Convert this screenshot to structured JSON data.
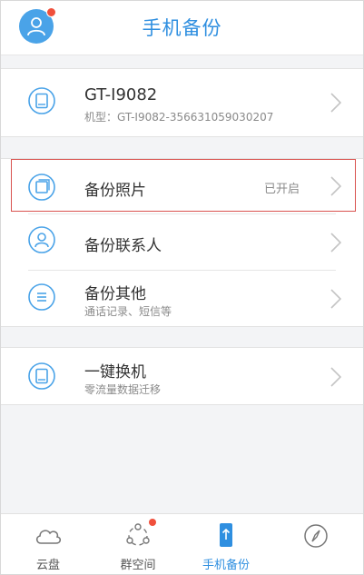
{
  "header": {
    "title": "手机备份"
  },
  "device": {
    "name": "GT-I9082",
    "model_line": "机型：GT-I9082-356631059030207"
  },
  "backup": {
    "photos": {
      "label": "备份照片",
      "status": "已开启"
    },
    "contacts": {
      "label": "备份联系人"
    },
    "other": {
      "label": "备份其他",
      "sub": "通话记录、短信等"
    }
  },
  "transfer": {
    "label": "一键换机",
    "sub": "零流量数据迁移"
  },
  "tabs": [
    {
      "label": "云盘"
    },
    {
      "label": "群空间"
    },
    {
      "label": "手机备份"
    },
    {
      "label": ""
    }
  ],
  "colors": {
    "accent": "#2f8fe0",
    "badge": "#f0503c",
    "highlight_border": "#d9534f"
  }
}
